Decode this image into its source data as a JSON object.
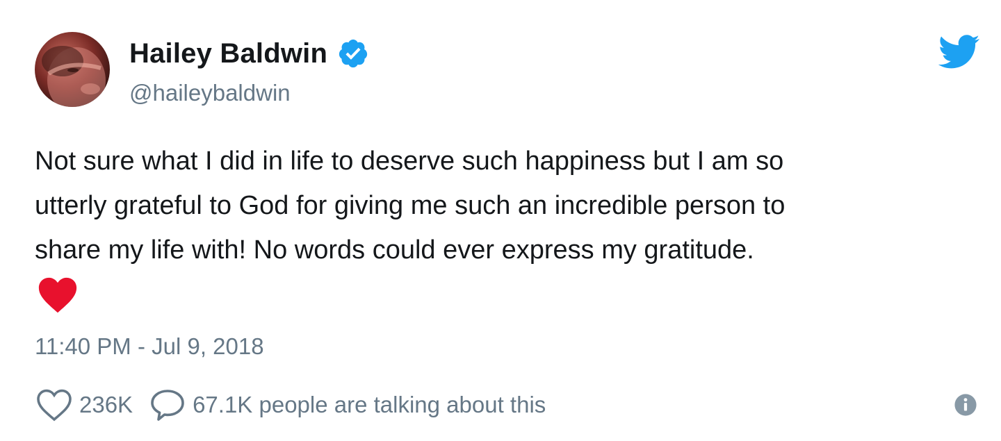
{
  "tweet": {
    "author": {
      "display_name": "Hailey Baldwin",
      "handle": "@haileybaldwin",
      "verified": true
    },
    "text": "Not sure what I did in life to deserve such happiness but I am so\nutterly grateful to God for giving me such an incredible person to\nshare my life with! No words could ever express my gratitude.",
    "emoji": "heart-emoji",
    "timestamp": "11:40 PM - Jul 9, 2018",
    "likes": "236K",
    "talking_about": "67.1K people are talking about this"
  },
  "icons": {
    "brand": "twitter-logo-icon",
    "verified": "verified-badge-icon",
    "like": "heart-outline-icon",
    "reply": "speech-bubble-icon",
    "info": "info-icon"
  },
  "colors": {
    "twitter_blue": "#1da1f2",
    "secondary_text": "#657786",
    "primary_text": "#14171a",
    "heart_red": "#e8112d"
  }
}
